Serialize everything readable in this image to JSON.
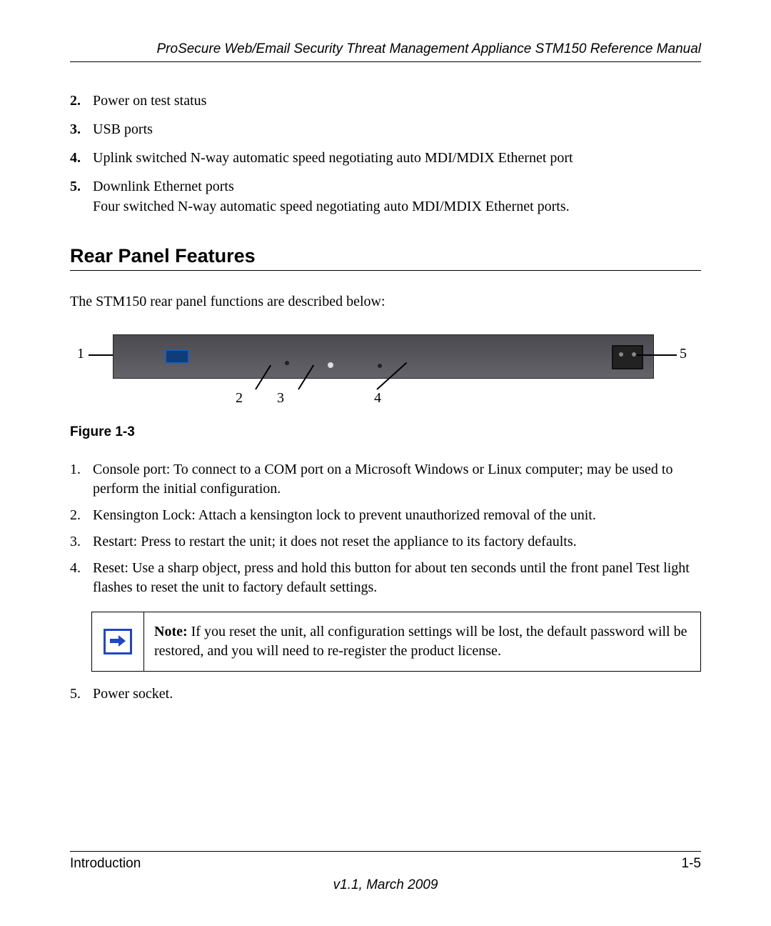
{
  "header": {
    "running_title": "ProSecure Web/Email Security Threat Management Appliance STM150 Reference Manual"
  },
  "top_list": [
    {
      "n": "2.",
      "text": "Power on test status"
    },
    {
      "n": "3.",
      "text": "USB ports"
    },
    {
      "n": "4.",
      "text": "Uplink switched N-way automatic speed negotiating auto MDI/MDIX Ethernet port"
    },
    {
      "n": "5.",
      "text": "Downlink Ethernet ports\nFour switched N-way automatic speed negotiating auto MDI/MDIX Ethernet ports."
    }
  ],
  "section_heading": "Rear Panel Features",
  "section_intro": "The STM150 rear panel functions are described below:",
  "figure": {
    "callouts": {
      "left": "1",
      "right": "5",
      "b2": "2",
      "b3": "3",
      "b4": "4"
    },
    "caption": "Figure 1-3"
  },
  "desc_list": [
    {
      "n": "1.",
      "text": "Console port: To connect to a COM port on a Microsoft Windows or Linux computer; may be used to perform the initial configuration."
    },
    {
      "n": "2.",
      "text": "Kensington Lock: Attach a kensington lock to prevent unauthorized removal of the unit."
    },
    {
      "n": "3.",
      "text": "Restart: Press to restart the unit; it does not reset the appliance to its factory defaults."
    },
    {
      "n": "4.",
      "text": "Reset: Use a sharp object, press and hold this button for about ten seconds until the front panel Test light flashes to reset the unit to factory default settings."
    }
  ],
  "note": {
    "label": "Note:",
    "body": " If you reset the unit, all configuration settings will be lost, the default password will be restored, and you will need to re-register the product license."
  },
  "after_note": {
    "n": "5.",
    "text": "Power socket."
  },
  "footer": {
    "section": "Introduction",
    "page": "1-5",
    "version": "v1.1, March 2009"
  }
}
